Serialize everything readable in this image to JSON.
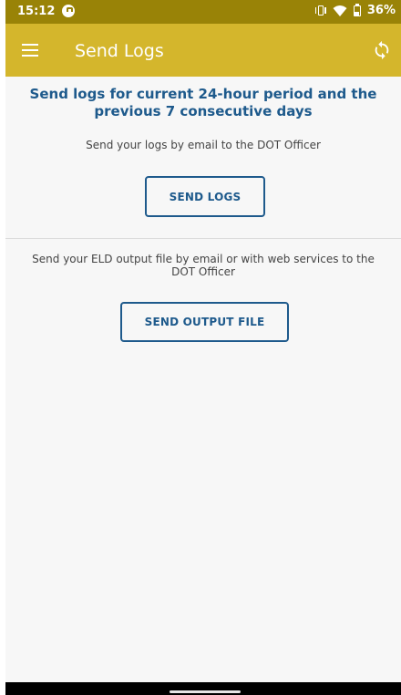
{
  "status_bar": {
    "time": "15:12",
    "battery": "36%",
    "icons": [
      "app-notification-icon",
      "vibrate-icon",
      "wifi-icon",
      "battery-icon"
    ]
  },
  "app_bar": {
    "title": "Send Logs",
    "menu_icon": "menu-icon",
    "sync_icon": "sync-icon",
    "color": "#d4b62c"
  },
  "main": {
    "heading": "Send logs for current 24-hour period and the previous 7 consecutive days",
    "logs_description": "Send your logs by email to the DOT Officer",
    "send_logs_label": "SEND LOGS",
    "output_description": "Send your ELD output file by email or with web services to the DOT Officer",
    "send_output_label": "SEND OUTPUT FILE"
  },
  "colors": {
    "status_bar": "#998307",
    "accent": "#1e5a8c",
    "background": "#f7f7f7"
  }
}
